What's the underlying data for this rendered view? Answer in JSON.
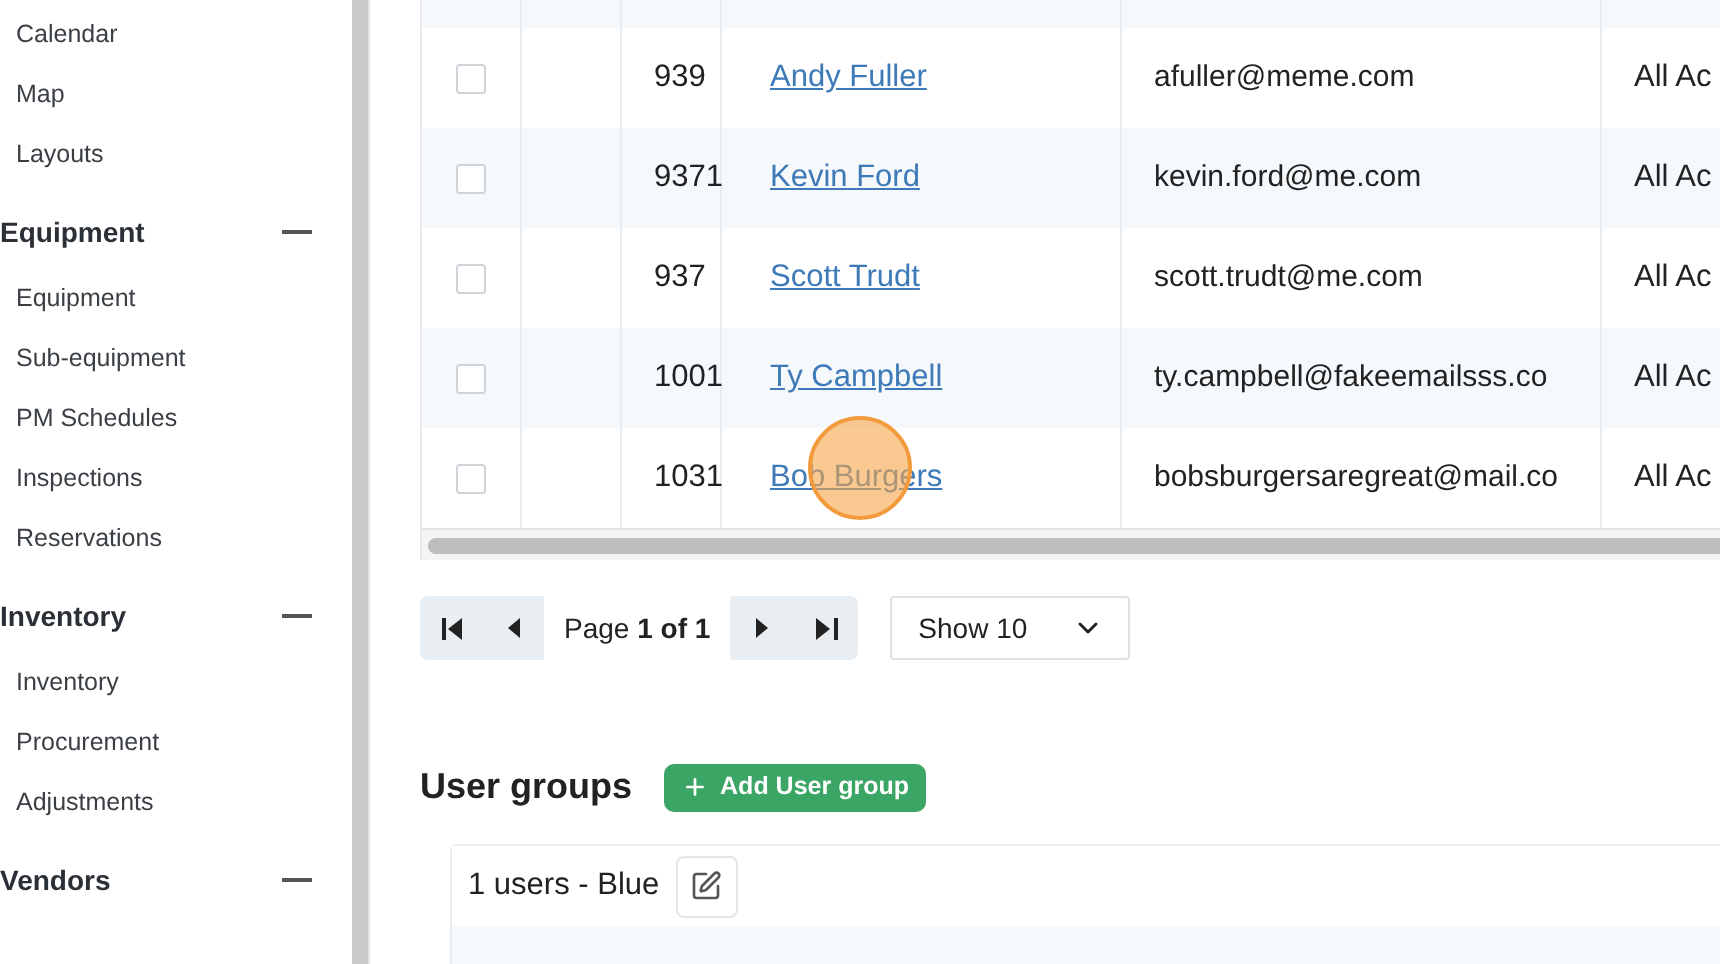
{
  "sidebar": {
    "items": [
      {
        "label": "Calendar"
      },
      {
        "label": "Map"
      },
      {
        "label": "Layouts"
      }
    ],
    "sections": [
      {
        "title": "Equipment",
        "expanded": true,
        "items": [
          {
            "label": "Equipment"
          },
          {
            "label": "Sub-equipment"
          },
          {
            "label": "PM Schedules"
          },
          {
            "label": "Inspections"
          },
          {
            "label": "Reservations"
          }
        ]
      },
      {
        "title": "Inventory",
        "expanded": true,
        "items": [
          {
            "label": "Inventory"
          },
          {
            "label": "Procurement"
          },
          {
            "label": "Adjustments"
          }
        ]
      },
      {
        "title": "Vendors",
        "expanded": true
      }
    ]
  },
  "table": {
    "rows": [
      {
        "checked": false,
        "id": "939",
        "name": "Andy Fuller",
        "email": "afuller@meme.com",
        "access": "All Ac"
      },
      {
        "checked": false,
        "id": "9371",
        "name": "Kevin Ford",
        "email": "kevin.ford@me.com",
        "access": "All Ac"
      },
      {
        "checked": false,
        "id": "937",
        "name": "Scott Trudt",
        "email": "scott.trudt@me.com",
        "access": "All Ac"
      },
      {
        "checked": false,
        "id": "1001",
        "name": "Ty Campbell",
        "email": "ty.campbell@fakeemailsss.co",
        "access": "All Ac"
      },
      {
        "checked": false,
        "id": "1031",
        "name": "Bob Burgers",
        "email": "bobsburgersaregreat@mail.co",
        "access": "All Ac"
      }
    ]
  },
  "pagination": {
    "page_label": "Page",
    "page_value": "1 of 1",
    "page_size": "Show 10"
  },
  "user_groups": {
    "title": "User groups",
    "add_button": "Add User group",
    "groups": [
      {
        "label": "1 users - Blue"
      }
    ]
  }
}
